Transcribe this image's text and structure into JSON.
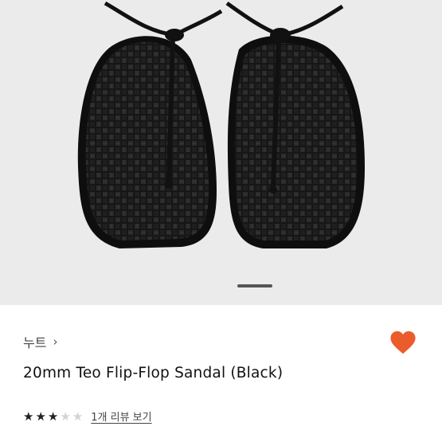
{
  "product": {
    "brand": "누트",
    "brand_chevron": "›",
    "title": "20mm Teo Flip-Flop Sandal (Black)",
    "rating": 3,
    "rating_max": 5,
    "reviews_link": "1개 리뷰 보기",
    "favorite": true
  },
  "gallery": {
    "image_alt": "Black woven flip-flop sandals",
    "active_index": 1
  },
  "colors": {
    "heart": "#ec5b2c",
    "star_filled": "#222222",
    "star_empty": "#d3d3d3",
    "hero_background": "#ebebeb"
  }
}
